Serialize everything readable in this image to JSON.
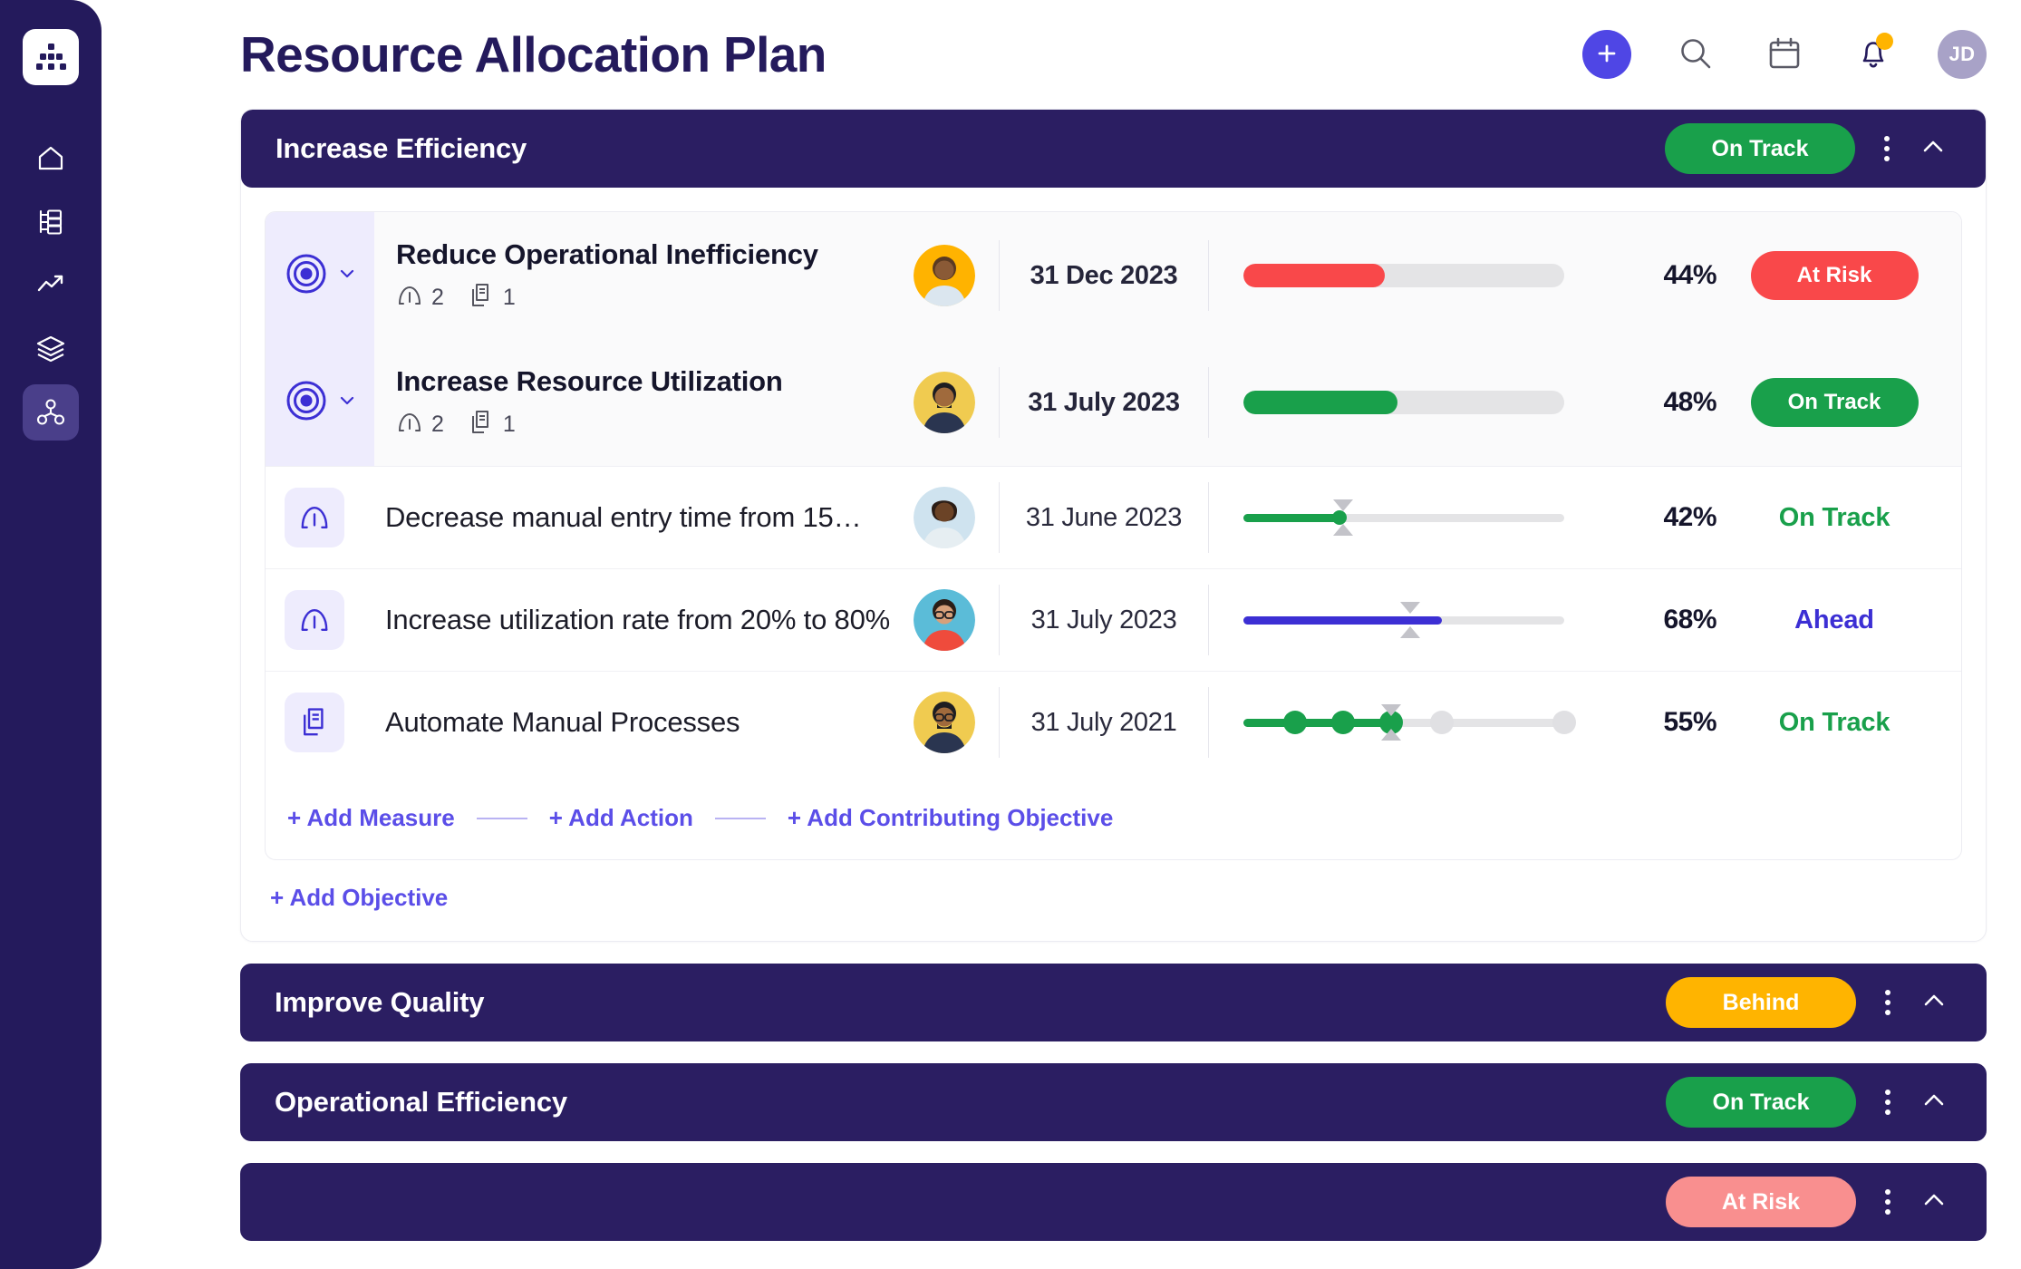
{
  "sidebar": {
    "logo_icon": "org-nodes-logo-icon",
    "items": [
      {
        "icon": "home-icon",
        "name": "home",
        "active": false
      },
      {
        "icon": "org-chart-icon",
        "name": "plans",
        "active": false
      },
      {
        "icon": "trend-up-icon",
        "name": "analytics",
        "active": false
      },
      {
        "icon": "layers-icon",
        "name": "layers",
        "active": false
      },
      {
        "icon": "network-nodes-icon",
        "name": "strategy-map",
        "active": true
      }
    ]
  },
  "header": {
    "title": "Resource Allocation Plan",
    "actions": [
      {
        "name": "add-button",
        "icon": "plus-icon"
      },
      {
        "name": "search-button",
        "icon": "search-icon"
      },
      {
        "name": "calendar-button",
        "icon": "calendar-icon"
      },
      {
        "name": "notifications-button",
        "icon": "bell-icon",
        "has_badge": true
      },
      {
        "name": "user-avatar",
        "icon": "avatar",
        "initials": "JD"
      }
    ]
  },
  "colors": {
    "navy": "#2b1e62",
    "green": "#19a04b",
    "red": "#f9484a",
    "amber": "#ffb400",
    "indigo": "#3c2fd4",
    "salmon": "#f98f8f",
    "link": "#5b4ee8"
  },
  "goals": [
    {
      "title": "Increase Efficiency",
      "status": "On Track",
      "status_color": "#19a04b",
      "expanded": true,
      "objectives": [
        {
          "icon": "target-icon",
          "name": "Reduce Operational Inefficiency",
          "measures_count": "2",
          "actions_count": "1",
          "avatar": "avatar-1",
          "date": "31 Dec 2023",
          "progress": 44,
          "percent": "44%",
          "bar_color": "#f9484a",
          "status": "At Risk",
          "status_color": "#f9484a",
          "status_style": "pill"
        },
        {
          "icon": "target-icon",
          "name": "Increase Resource Utilization",
          "measures_count": "2",
          "actions_count": "1",
          "avatar": "avatar-2",
          "date": "31 July 2023",
          "progress": 48,
          "percent": "48%",
          "bar_color": "#19a04b",
          "status": "On Track",
          "status_color": "#19a04b",
          "status_style": "pill"
        }
      ],
      "children": [
        {
          "icon": "measure-gauge-icon",
          "name": "Decrease manual entry time from 15…",
          "avatar": "avatar-3",
          "date": "31 June 2023",
          "progress": 30,
          "target": 31,
          "percent": "42%",
          "bar_color": "#19a04b",
          "status": "On Track",
          "status_color": "#19a04b",
          "status_style": "text",
          "type": "slider"
        },
        {
          "icon": "measure-gauge-icon",
          "name": "Increase utilization rate from 20% to 80%",
          "avatar": "avatar-4",
          "date": "31 July 2023",
          "progress": 62,
          "target": 52,
          "percent": "68%",
          "bar_color": "#3c2fd4",
          "status": "Ahead",
          "status_color": "#3c2fd4",
          "status_style": "text",
          "type": "slider"
        },
        {
          "icon": "action-docs-icon",
          "name": "Automate Manual Processes",
          "avatar": "avatar-5",
          "date": "31 July 2021",
          "progress": 46,
          "target": 46,
          "percent": "55%",
          "bar_color": "#19a04b",
          "status": "On Track",
          "status_color": "#19a04b",
          "status_style": "text",
          "type": "milestones",
          "milestones": [
            {
              "pos": 16,
              "done": true
            },
            {
              "pos": 31,
              "done": true
            },
            {
              "pos": 46,
              "done": true
            },
            {
              "pos": 62,
              "done": false
            },
            {
              "pos": 100,
              "done": false
            }
          ]
        }
      ],
      "add_links": [
        "+ Add Measure",
        "+ Add Action",
        "+ Add Contributing Objective"
      ],
      "add_objective_label": "+ Add Objective"
    },
    {
      "title": "Improve Quality",
      "status": "Behind",
      "status_color": "#ffb400",
      "expanded": false
    },
    {
      "title": "Operational Efficiency",
      "status": "On Track",
      "status_color": "#19a04b",
      "expanded": false
    },
    {
      "title": "",
      "status": "At Risk",
      "status_color": "#f98f8f",
      "expanded": false
    }
  ]
}
